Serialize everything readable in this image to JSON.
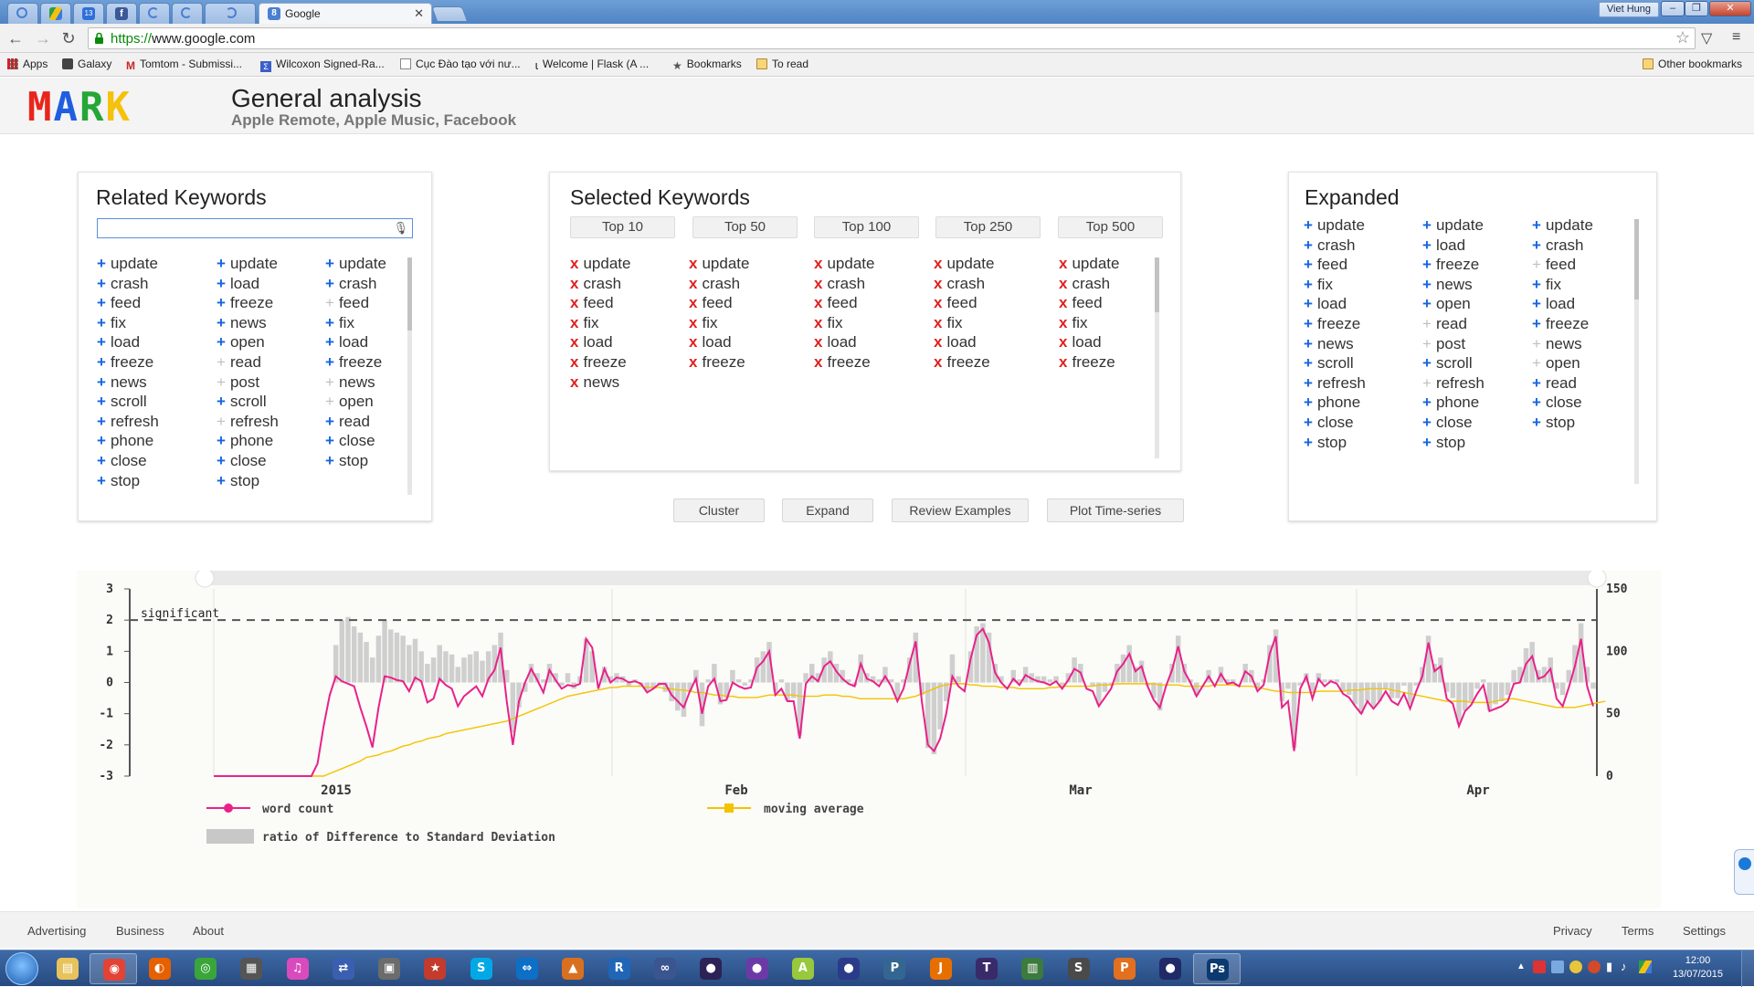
{
  "browser": {
    "active_tab_title": "Google",
    "active_tab_favicon": "8",
    "user_name": "Viet Hung",
    "url_scheme": "https://",
    "url_rest": "www.google.com",
    "window_buttons": [
      "–",
      "❐",
      "✕"
    ]
  },
  "bookmarks": [
    {
      "label": "Apps",
      "icon": "apps-grid-icon"
    },
    {
      "label": "Galaxy",
      "icon": "galaxy-icon"
    },
    {
      "label": "Tomtom - Submissi...",
      "icon": "gmail-icon"
    },
    {
      "label": "Wilcoxon Signed-Ra...",
      "icon": "sigma-icon"
    },
    {
      "label": "Cục Đào tạo với nư...",
      "icon": "page-icon"
    },
    {
      "label": "Welcome | Flask (A ...",
      "icon": "flask-icon"
    },
    {
      "label": "Bookmarks",
      "icon": "star-icon"
    },
    {
      "label": "To read",
      "icon": "folder-icon"
    }
  ],
  "other_bookmarks": "Other bookmarks",
  "header": {
    "logo_letters": [
      {
        "ch": "M",
        "color": "#e8261c"
      },
      {
        "ch": "A",
        "color": "#1f5ee0"
      },
      {
        "ch": "R",
        "color": "#26a637"
      },
      {
        "ch": "K",
        "color": "#f4c20d"
      }
    ],
    "title": "General analysis",
    "subtitle": "Apple Remote, Apple Music, Facebook"
  },
  "related": {
    "title": "Related Keywords",
    "search_value": "",
    "columns": [
      [
        {
          "t": "update",
          "dim": false
        },
        {
          "t": "crash",
          "dim": false
        },
        {
          "t": "feed",
          "dim": false
        },
        {
          "t": "fix",
          "dim": false
        },
        {
          "t": "load",
          "dim": false
        },
        {
          "t": "freeze",
          "dim": false
        },
        {
          "t": "news",
          "dim": false
        },
        {
          "t": "scroll",
          "dim": false
        },
        {
          "t": "refresh",
          "dim": false
        },
        {
          "t": "phone",
          "dim": false
        },
        {
          "t": "close",
          "dim": false
        },
        {
          "t": "stop",
          "dim": false
        }
      ],
      [
        {
          "t": "update",
          "dim": false
        },
        {
          "t": "load",
          "dim": false
        },
        {
          "t": "freeze",
          "dim": false
        },
        {
          "t": "news",
          "dim": false
        },
        {
          "t": "open",
          "dim": false
        },
        {
          "t": "read",
          "dim": true
        },
        {
          "t": "post",
          "dim": true
        },
        {
          "t": "scroll",
          "dim": false
        },
        {
          "t": "refresh",
          "dim": true
        },
        {
          "t": "phone",
          "dim": false
        },
        {
          "t": "close",
          "dim": false
        },
        {
          "t": "stop",
          "dim": false
        }
      ],
      [
        {
          "t": "update",
          "dim": false
        },
        {
          "t": "crash",
          "dim": false
        },
        {
          "t": "feed",
          "dim": true
        },
        {
          "t": "fix",
          "dim": false
        },
        {
          "t": "load",
          "dim": false
        },
        {
          "t": "freeze",
          "dim": false
        },
        {
          "t": "news",
          "dim": true
        },
        {
          "t": "open",
          "dim": true
        },
        {
          "t": "read",
          "dim": false
        },
        {
          "t": "close",
          "dim": false
        },
        {
          "t": "stop",
          "dim": false
        }
      ]
    ]
  },
  "selected": {
    "title": "Selected Keywords",
    "pills": [
      "Top 10",
      "Top 50",
      "Top 100",
      "Top 250",
      "Top 500"
    ],
    "columns": [
      [
        "update",
        "crash",
        "feed",
        "fix",
        "load",
        "freeze",
        "news"
      ],
      [
        "update",
        "crash",
        "feed",
        "fix",
        "load",
        "freeze"
      ],
      [
        "update",
        "crash",
        "feed",
        "fix",
        "load",
        "freeze"
      ],
      [
        "update",
        "crash",
        "feed",
        "fix",
        "load",
        "freeze"
      ],
      [
        "update",
        "crash",
        "feed",
        "fix",
        "load",
        "freeze"
      ]
    ]
  },
  "expanded": {
    "title": "Expanded",
    "columns": [
      [
        {
          "t": "update",
          "dim": false
        },
        {
          "t": "crash",
          "dim": false
        },
        {
          "t": "feed",
          "dim": false
        },
        {
          "t": "fix",
          "dim": false
        },
        {
          "t": "load",
          "dim": false
        },
        {
          "t": "freeze",
          "dim": false
        },
        {
          "t": "news",
          "dim": false
        },
        {
          "t": "scroll",
          "dim": false
        },
        {
          "t": "refresh",
          "dim": false
        },
        {
          "t": "phone",
          "dim": false
        },
        {
          "t": "close",
          "dim": false
        },
        {
          "t": "stop",
          "dim": false
        }
      ],
      [
        {
          "t": "update",
          "dim": false
        },
        {
          "t": "load",
          "dim": false
        },
        {
          "t": "freeze",
          "dim": false
        },
        {
          "t": "news",
          "dim": false
        },
        {
          "t": "open",
          "dim": false
        },
        {
          "t": "read",
          "dim": true
        },
        {
          "t": "post",
          "dim": true
        },
        {
          "t": "scroll",
          "dim": false
        },
        {
          "t": "refresh",
          "dim": true
        },
        {
          "t": "phone",
          "dim": false
        },
        {
          "t": "close",
          "dim": false
        },
        {
          "t": "stop",
          "dim": false
        }
      ],
      [
        {
          "t": "update",
          "dim": false
        },
        {
          "t": "crash",
          "dim": false
        },
        {
          "t": "feed",
          "dim": true
        },
        {
          "t": "fix",
          "dim": false
        },
        {
          "t": "load",
          "dim": false
        },
        {
          "t": "freeze",
          "dim": false
        },
        {
          "t": "news",
          "dim": true
        },
        {
          "t": "open",
          "dim": true
        },
        {
          "t": "read",
          "dim": false
        },
        {
          "t": "close",
          "dim": false
        },
        {
          "t": "stop",
          "dim": false
        }
      ]
    ]
  },
  "actions": [
    "Cluster",
    "Expand",
    "Review Examples",
    "Plot Time-series"
  ],
  "chart_data": {
    "type": "line",
    "left_axis": {
      "ticks": [
        3,
        2,
        1,
        0,
        -1,
        -2,
        -3
      ],
      "range": [
        -3,
        3
      ]
    },
    "right_axis": {
      "ticks": [
        150,
        100,
        50,
        0
      ],
      "range": [
        0,
        150
      ]
    },
    "x_tick_labels": [
      "2015",
      "Feb",
      "Mar",
      "Apr"
    ],
    "threshold": {
      "value": 2,
      "label": "significant"
    },
    "legend": [
      {
        "name": "word count",
        "color": "#e8228a"
      },
      {
        "name": "moving average",
        "color": "#f3c300"
      },
      {
        "name": "ratio of Difference to Standard Deviation",
        "color": "#c8c8c8"
      }
    ],
    "word_count": [
      0,
      0,
      0,
      0,
      0,
      0,
      0,
      0,
      0,
      0,
      0,
      0,
      0,
      0,
      0,
      0,
      0,
      10,
      40,
      65,
      80,
      76,
      74,
      72,
      55,
      40,
      23,
      55,
      80,
      79,
      77,
      76,
      68,
      79,
      76,
      59,
      62,
      78,
      73,
      70,
      56,
      64,
      68,
      72,
      64,
      78,
      85,
      103,
      60,
      25,
      60,
      75,
      86,
      77,
      67,
      85,
      77,
      70,
      73,
      72,
      74,
      110,
      103,
      70,
      86,
      75,
      79,
      78,
      75,
      76,
      74,
      67,
      70,
      74,
      74,
      65,
      60,
      55,
      68,
      78,
      50,
      72,
      78,
      60,
      61,
      75,
      72,
      70,
      71,
      87,
      92,
      100,
      65,
      70,
      60,
      60,
      30,
      74,
      80,
      76,
      88,
      92,
      84,
      78,
      74,
      72,
      90,
      78,
      76,
      72,
      80,
      72,
      60,
      70,
      90,
      108,
      60,
      25,
      20,
      30,
      50,
      80,
      72,
      68,
      94,
      113,
      118,
      107,
      83,
      75,
      70,
      78,
      73,
      81,
      78,
      76,
      75,
      73,
      76,
      70,
      77,
      86,
      83,
      70,
      68,
      56,
      63,
      70,
      84,
      90,
      98,
      84,
      88,
      72,
      61,
      55,
      72,
      85,
      104,
      84,
      75,
      64,
      72,
      80,
      72,
      82,
      74,
      75,
      72,
      84,
      80,
      68,
      73,
      98,
      112,
      55,
      60,
      20,
      70,
      80,
      62,
      78,
      72,
      76,
      74,
      66,
      63,
      56,
      50,
      60,
      54,
      60,
      68,
      60,
      57,
      66,
      54,
      68,
      80,
      107,
      84,
      88,
      62,
      58,
      40,
      52,
      57,
      66,
      73,
      52,
      54,
      56,
      60,
      74,
      75,
      90,
      96,
      78,
      80,
      86,
      62,
      56,
      71,
      88,
      110,
      72,
      56
    ],
    "moving_average": [
      0,
      0,
      0,
      0,
      0,
      0,
      0,
      0,
      0,
      0,
      0,
      0,
      0,
      0,
      0,
      0,
      0,
      0,
      0,
      2,
      4,
      6,
      8,
      10,
      12,
      15,
      16,
      17,
      19,
      20,
      22,
      24,
      25,
      27,
      28,
      30,
      31,
      32,
      34,
      35,
      36,
      37,
      38,
      39,
      40,
      41,
      42,
      43,
      44,
      46,
      48,
      50,
      52,
      54,
      56,
      58,
      60,
      62,
      64,
      65,
      66,
      67,
      68,
      69,
      70,
      71,
      71,
      72,
      72,
      72,
      72,
      71,
      71,
      71,
      70,
      70,
      69,
      69,
      68,
      67,
      67,
      66,
      65,
      65,
      64,
      64,
      63,
      63,
      63,
      63,
      64,
      65,
      65,
      65,
      65,
      65,
      64,
      64,
      64,
      64,
      65,
      65,
      65,
      64,
      64,
      63,
      62,
      62,
      62,
      62,
      62,
      62,
      62,
      62,
      63,
      64,
      66,
      68,
      70,
      72,
      73,
      74,
      74,
      74,
      73,
      73,
      72,
      72,
      72,
      71,
      71,
      71,
      70,
      70,
      70,
      70,
      70,
      71,
      71,
      72,
      72,
      72,
      72,
      72,
      72,
      73,
      73,
      73,
      74,
      74,
      74,
      74,
      74,
      74,
      74,
      73,
      73,
      73,
      73,
      72,
      72,
      72,
      72,
      72,
      73,
      73,
      73,
      73,
      72,
      72,
      72,
      71,
      70,
      69,
      68,
      68,
      67,
      67,
      67,
      67,
      67,
      68,
      68,
      68,
      68,
      68,
      69,
      69,
      69,
      70,
      70,
      70,
      70,
      69,
      68,
      67,
      66,
      65,
      64,
      63,
      62,
      61,
      60,
      60,
      60,
      60,
      59,
      59,
      59,
      59,
      60,
      61,
      62,
      62,
      61,
      60,
      59,
      58,
      57,
      56,
      55,
      55,
      55,
      55,
      56,
      57,
      58,
      59,
      60
    ],
    "ratio": [
      0,
      0,
      0,
      0,
      0,
      0,
      0,
      0,
      0,
      0,
      0,
      0,
      0,
      0,
      0,
      0,
      0,
      0,
      0,
      0,
      1.2,
      2.0,
      2.1,
      1.8,
      1.6,
      1.3,
      0.8,
      1.5,
      2.0,
      1.7,
      1.6,
      1.5,
      1.2,
      1.4,
      1.0,
      0.6,
      0.8,
      1.2,
      1.0,
      0.9,
      0.5,
      0.8,
      0.9,
      1.0,
      0.7,
      1.0,
      1.2,
      1.6,
      0.4,
      -1.6,
      -0.8,
      -0.3,
      0.6,
      0.3,
      0.1,
      0.6,
      0.3,
      -0.1,
      0.3,
      -0.2,
      0.2,
      1.4,
      1.0,
      0,
      0.5,
      0.2,
      0.3,
      0.2,
      -0.1,
      0.1,
      -0.1,
      -0.3,
      -0.2,
      -0.1,
      -0.3,
      -0.6,
      -0.9,
      -1.1,
      -0.3,
      0.4,
      -1.4,
      0.1,
      0.6,
      -0.7,
      -0.5,
      0.4,
      0.1,
      -0.1,
      0.1,
      0.8,
      1.0,
      1.3,
      -0.3,
      0.1,
      -0.6,
      -0.5,
      -1.7,
      0.3,
      0.6,
      0.3,
      0.8,
      1.0,
      0.6,
      0.4,
      0.1,
      -0.1,
      0.9,
      0.3,
      0.2,
      0.1,
      0.5,
      0.1,
      -0.5,
      0.1,
      0.8,
      1.6,
      -0.4,
      -2.1,
      -2.3,
      -1.5,
      -0.6,
      0.9,
      0.2,
      0,
      1.0,
      1.8,
      1.9,
      1.6,
      0.6,
      0.2,
      0,
      0.4,
      0.1,
      0.5,
      0.3,
      0.2,
      0.2,
      0.1,
      0.2,
      -0.1,
      0.3,
      0.8,
      0.6,
      0,
      -0.1,
      -0.7,
      -0.3,
      -0.1,
      0.6,
      0.9,
      1.2,
      0.5,
      0.7,
      -0.1,
      -0.5,
      -0.9,
      0,
      0.6,
      1.5,
      0.6,
      0.1,
      -0.4,
      0,
      0.4,
      0,
      0.5,
      0.1,
      0.1,
      0,
      0.6,
      0.4,
      -0.2,
      0.1,
      1.2,
      1.7,
      -0.6,
      -0.2,
      -2.1,
      -0.1,
      0.3,
      -0.3,
      0.3,
      0.1,
      0.1,
      0.1,
      -0.3,
      -0.4,
      -0.7,
      -1.0,
      -0.6,
      -0.8,
      -0.6,
      -0.2,
      -0.5,
      -0.5,
      -0.1,
      -0.7,
      -0.1,
      0.5,
      1.5,
      0.6,
      0.8,
      -0.3,
      -0.5,
      -1.3,
      -0.9,
      -0.6,
      -0.2,
      0.1,
      -0.9,
      -0.7,
      -0.6,
      -0.4,
      0.4,
      0.5,
      1.1,
      1.3,
      0.4,
      0.5,
      0.8,
      -0.2,
      -0.4,
      0.4,
      1.2,
      1.9,
      0.5,
      -0.2
    ]
  },
  "footer": {
    "left": [
      "Advertising",
      "Business",
      "About"
    ],
    "right": [
      "Privacy",
      "Terms",
      "Settings"
    ]
  },
  "taskbar": {
    "apps": [
      {
        "name": "explorer-icon",
        "glyph": "▤",
        "color": "#e8c25a"
      },
      {
        "name": "chrome-icon",
        "glyph": "◉",
        "color": "#e34234",
        "active": true
      },
      {
        "name": "firefox-icon",
        "glyph": "◐",
        "color": "#e66000"
      },
      {
        "name": "greenshot-icon",
        "glyph": "◎",
        "color": "#3aa63a"
      },
      {
        "name": "video-editor-icon",
        "glyph": "▦",
        "color": "#555555"
      },
      {
        "name": "itunes-icon",
        "glyph": "♫",
        "color": "#d94bbd"
      },
      {
        "name": "network-icon",
        "glyph": "⇄",
        "color": "#3a5fb0"
      },
      {
        "name": "clipboard-icon",
        "glyph": "▣",
        "color": "#6c6c6c"
      },
      {
        "name": "presentation-icon",
        "glyph": "★",
        "color": "#c33b2c"
      },
      {
        "name": "skype-icon",
        "glyph": "S",
        "color": "#00a9e6"
      },
      {
        "name": "teamviewer-icon",
        "glyph": "⇔",
        "color": "#0e6fc7"
      },
      {
        "name": "matlab-icon",
        "glyph": "▲",
        "color": "#d9701f"
      },
      {
        "name": "r-icon",
        "glyph": "R",
        "color": "#2165b6"
      },
      {
        "name": "link-icon",
        "glyph": "∞",
        "color": "#3a5590"
      },
      {
        "name": "eclipse-icon",
        "glyph": "●",
        "color": "#2c2255"
      },
      {
        "name": "eclipse-purple-icon",
        "glyph": "●",
        "color": "#6c3aa6"
      },
      {
        "name": "android-icon",
        "glyph": "A",
        "color": "#98c83c"
      },
      {
        "name": "eclipse-blue-icon",
        "glyph": "●",
        "color": "#2c3a8a"
      },
      {
        "name": "postgres-icon",
        "glyph": "P",
        "color": "#336791"
      },
      {
        "name": "java-icon",
        "glyph": "J",
        "color": "#e76f00"
      },
      {
        "name": "tex-icon",
        "glyph": "T",
        "color": "#3a2a6a"
      },
      {
        "name": "chart-app-icon",
        "glyph": "▥",
        "color": "#3d7a3d"
      },
      {
        "name": "sublime-icon",
        "glyph": "S",
        "color": "#4a4a4a"
      },
      {
        "name": "pdf-icon",
        "glyph": "P",
        "color": "#e2701e"
      },
      {
        "name": "eclipse-dark-icon",
        "glyph": "●",
        "color": "#1f2a66"
      },
      {
        "name": "photoshop-icon",
        "glyph": "Ps",
        "color": "#0b3a70",
        "active": true
      }
    ],
    "clock_time": "12:00",
    "clock_date": "13/07/2015"
  }
}
